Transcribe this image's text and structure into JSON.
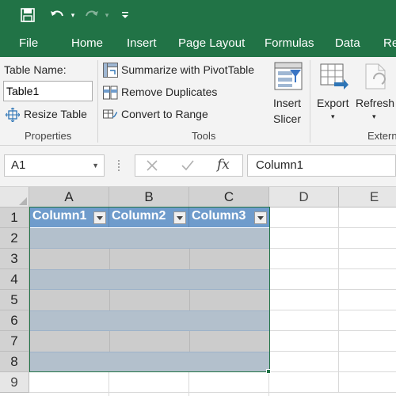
{
  "ribbon": {
    "tabs": [
      {
        "label": "File"
      },
      {
        "label": "Home"
      },
      {
        "label": "Insert"
      },
      {
        "label": "Page Layout"
      },
      {
        "label": "Formulas"
      },
      {
        "label": "Data"
      },
      {
        "label": "Re"
      }
    ],
    "properties": {
      "table_name_label": "Table Name:",
      "table_name_value": "Table1",
      "resize_table_label": "Resize Table",
      "group_label": "Properties"
    },
    "tools": {
      "summarize_label": "Summarize with PivotTable",
      "remove_duplicates_label": "Remove Duplicates",
      "convert_label": "Convert to Range",
      "group_label": "Tools"
    },
    "insert_slicer": {
      "line1": "Insert",
      "line2": "Slicer"
    },
    "export": {
      "label": "Export"
    },
    "refresh": {
      "label": "Refresh"
    },
    "external_group_label": "Extern"
  },
  "formula_bar": {
    "name_box": "A1",
    "fx_label": "fx",
    "content": "Column1"
  },
  "sheet": {
    "columns": [
      "A",
      "B",
      "C",
      "D",
      "E"
    ],
    "rows": [
      "1",
      "2",
      "3",
      "4",
      "5",
      "6",
      "7",
      "8",
      "9"
    ],
    "table_headers": [
      "Column1",
      "Column2",
      "Column3"
    ]
  },
  "colors": {
    "accent": "#217346",
    "table_header": "#6f9ccc",
    "table_band": "#b3c0cc",
    "table_row": "#cccccc"
  }
}
